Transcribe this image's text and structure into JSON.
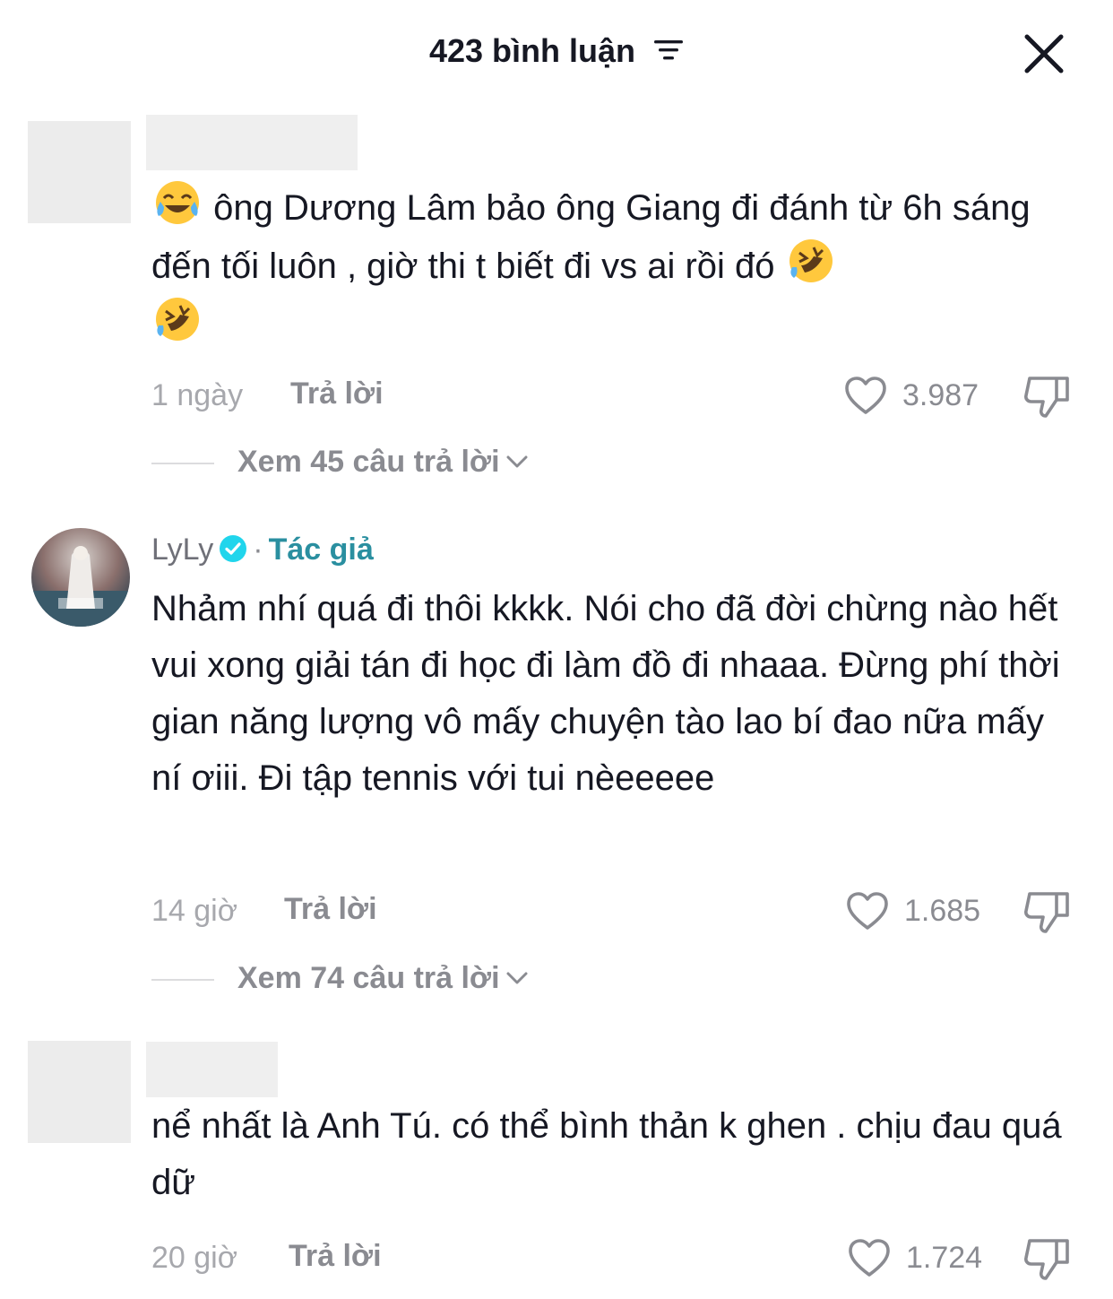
{
  "header": {
    "title": "423 bình luận"
  },
  "comments": [
    {
      "text_parts": [
        "ông Dương Lâm bảo ông Giang đi đánh từ 6h sáng đến tối luôn , giờ thi t biết đi vs ai rồi đó"
      ],
      "emojis": [
        "face-with-tears-of-joy",
        "rolling-on-floor-laughing",
        "rolling-on-floor-laughing"
      ],
      "time": "1 ngày",
      "reply_label": "Trả lời",
      "likes": "3.987",
      "view_replies": "Xem 45 câu trả lời"
    },
    {
      "author": "LyLy",
      "author_separator": "·",
      "author_tag": "Tác giả",
      "text": "Nhảm nhí quá đi thôi kkkk. Nói cho đã đời chừng nào hết vui xong giải tán đi học đi làm đồ đi nhaaa. Đừng phí thời gian năng lượng vô mấy chuyện tào lao bí đao nữa mấy ní ơiii. Đi tập tennis với tui nèeeeee",
      "time": "14 giờ",
      "reply_label": "Trả lời",
      "likes": "1.685",
      "view_replies": "Xem 74 câu trả lời"
    },
    {
      "text": "nể nhất là Anh Tú. có thể bình thản k ghen . chịu đau quá dữ",
      "time": "20 giờ",
      "reply_label": "Trả lời",
      "likes": "1.724"
    }
  ],
  "colors": {
    "text": "#161823",
    "muted": "#8a8b91",
    "author_tag": "#2a8fa0",
    "verified": "#20d5ec"
  },
  "icons": [
    "sort-icon",
    "close-icon",
    "heart-icon",
    "dislike-icon",
    "verified-icon",
    "chevron-down-icon"
  ]
}
